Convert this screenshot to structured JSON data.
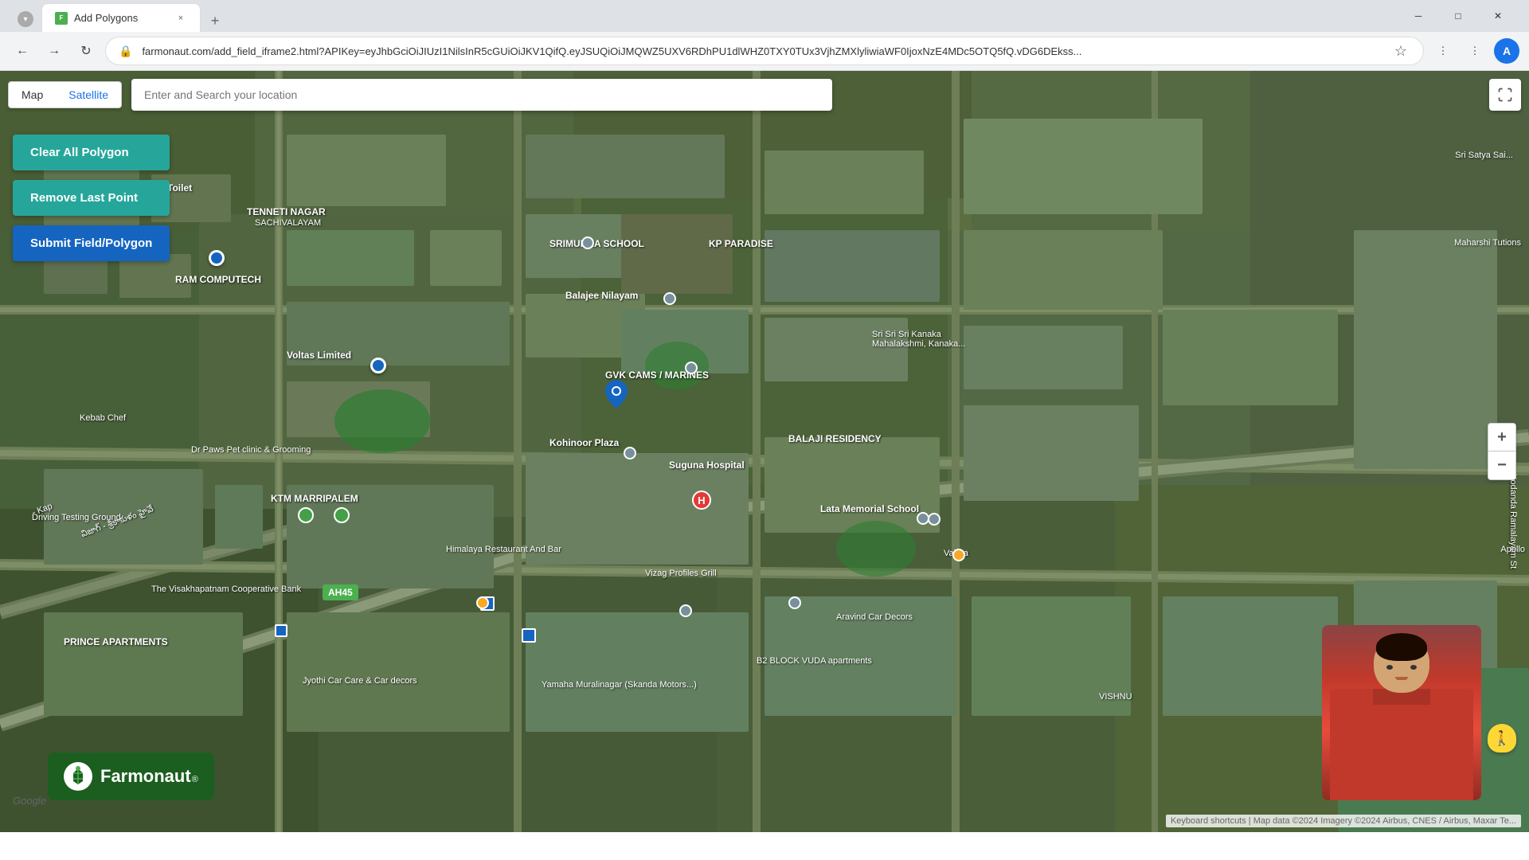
{
  "browser": {
    "tab": {
      "title": "Add Polygons",
      "favicon_text": "F"
    },
    "new_tab_label": "+",
    "nav": {
      "back_icon": "←",
      "forward_icon": "→",
      "reload_icon": "↻",
      "address": "farmonaut.com/add_field_iframe2.html?APIKey=eyJhbGciOiJIUzI1NilsInR5cGUiOiJKV1QifQ.eyJSUQiOiJMQWZ5UXV6RDhPU1dlWHZ0TXY0TUx3VjhZMXlyliwiaWF0IjoxNzE4MDc5OTQ5fQ.vDG6DEkss...",
      "profile_letter": "A"
    }
  },
  "map": {
    "type_buttons": [
      {
        "label": "Map",
        "active": false
      },
      {
        "label": "Satellite",
        "active": true
      }
    ],
    "search_placeholder": "Enter and Search your location",
    "fullscreen_icon": "⛶",
    "buttons": {
      "clear_polygon": "Clear All Polygon",
      "remove_last_point": "Remove Last Point",
      "submit": "Submit Field/Polygon"
    },
    "colors": {
      "clear_polygon_bg": "#26a69a",
      "remove_last_point_bg": "#26a69a",
      "submit_bg": "#1565c0",
      "marker_blue": "#1565c0"
    },
    "labels": {
      "sbm_toilet": "SBM Toilet",
      "tenneti_nagar": "TENNETI NAGAR",
      "sachivalayam": "SACHIVALAYAM",
      "ram_computech": "RAM COMPUTECH",
      "srimukha_school": "SRIMUKHA SCHOOL",
      "kp_paradise": "KP PARADISE",
      "balajee_nilayam": "Balajee Nilayam",
      "voltas": "Voltas Limited",
      "gvk_cams": "GVK CAMS / MARINES",
      "kohinoor_plaza": "Kohinoor Plaza",
      "balaji_residency": "BALAJI RESIDENCY",
      "suguna_hospital": "Suguna Hospital",
      "lata_memorial": "Lata Memorial School",
      "himalaya_restaurant": "Himalaya Restaurant And Bar",
      "dr_paws": "Dr Paws Pet clinic & Grooming",
      "ktm_marripalem": "KTM MARRIPALEM",
      "visakhapatnam_bank": "The Visakhapatnam Cooperative Bank",
      "prince_apartments": "PRINCE APARTMENTS",
      "ah45": "AH45",
      "vizag_profiles": "Vizag Profiles Grill",
      "vajraa": "Vajraa",
      "aravind_car": "Aravind Car Decors",
      "b2_block": "B2 BLOCK VUDA apartments",
      "yamaha": "Yamaha Muralinagar (Skanda Motors...)",
      "jyothi_car": "Jyothi Car Care & Car decors",
      "kodanda": "Kodanda Ramalayam St",
      "driving_ground": "Driving Testing Ground",
      "kebab_chef": "Kebab Chef",
      "sri_sri_sri": "Sri Sri Sri Kanaka Mahalakshmi, Kanaka...",
      "vishnu": "VISHNU"
    },
    "attribution": "Keyboard shortcuts | Map data ©2024 Imagery ©2024 Airbus, CNES / Airbus, Maxar Te...",
    "google_text": "Google"
  },
  "farmonaut": {
    "logo_letter": "F",
    "name": "Farmonaut",
    "registered": "®"
  },
  "icons": {
    "zoom_in": "+",
    "zoom_out": "−",
    "pegman": "🚶",
    "back": "←",
    "forward": "→",
    "reload": "↻",
    "bookmark": "☆",
    "close_tab": "×",
    "lock": "🔒",
    "hospital_letter": "H"
  }
}
